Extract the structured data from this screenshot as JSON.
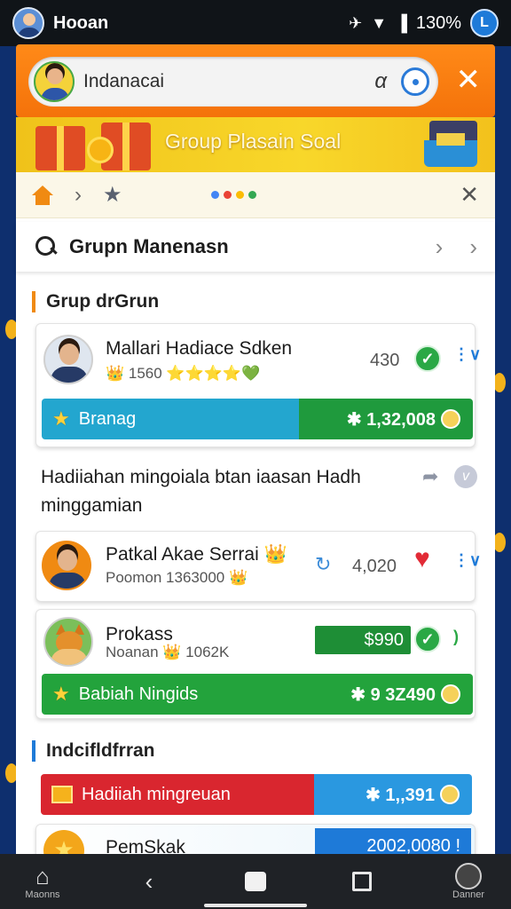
{
  "status_bar": {
    "title": "Hooan",
    "battery": "130%",
    "signal_glyph": "✈",
    "wifi_glyph": "▼",
    "bars_glyph": "▐",
    "circle_glyph": "L"
  },
  "header": {
    "search_text": "Indanacai",
    "alpha_glyph": "α",
    "close_glyph": "✕"
  },
  "banner": {
    "text": "Group Plasain Soal"
  },
  "nav": {
    "chevron": "›",
    "star": "★",
    "close": "✕",
    "dot_colors": [
      "#4285f4",
      "#ea4335",
      "#fbbc05",
      "#34a853"
    ]
  },
  "title_row": {
    "text": "Grupn Manenasn",
    "chev1": "›",
    "chev2": "›"
  },
  "section1": {
    "label": "Grup drGrun"
  },
  "row1": {
    "name": "Mallari Hadiace Sdken",
    "sub": "👑 1560 ⭐⭐⭐⭐💚",
    "value": "430",
    "bar_label": "Branag",
    "bar_value": "✱ 1,32,008",
    "bar_left_color": "#23a6cf",
    "bar_right_color": "#1f9a3d"
  },
  "info": {
    "text": "Hadiiahan mingoiala btan iaasan Hadh minggamian",
    "share_glyph": "➦",
    "circle_glyph": "v"
  },
  "row2": {
    "name": "Patkal Akae Serrai 👑",
    "sub": "Poomon 1363000 👑",
    "value": "4,020",
    "refresh_glyph": "↻",
    "heart_glyph": "♥"
  },
  "row3": {
    "name": "Prokass",
    "sub": "Noanan 👑 1062K",
    "pill_value": "$990",
    "arrow_glyph": ")",
    "bar_label": "Babiah Ningids",
    "bar_value": "✱ 9 3Z490",
    "bar_color": "#23a33c"
  },
  "section2": {
    "label": "Indcifldfrran"
  },
  "row4": {
    "bar_label": "Hadiiah mingreuan",
    "bar_value": "✱ 1,,391",
    "bar_left_color": "#d9262f",
    "bar_right_color": "#2a98e0"
  },
  "row5": {
    "name": "PemSkak",
    "value": "2002,0080 !"
  },
  "bottom_nav": {
    "home_label": "Maonns",
    "back_glyph": "‹",
    "profile_label": "Danner"
  }
}
